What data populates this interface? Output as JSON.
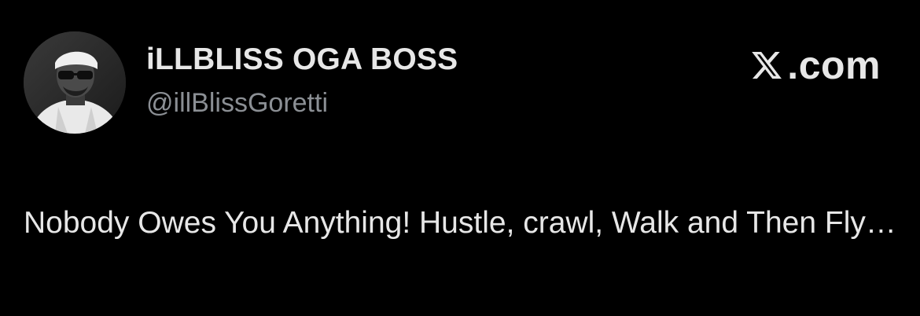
{
  "tweet": {
    "author": {
      "display_name": "iLLBLISS OGA BOSS",
      "handle": "@illBlissGoretti",
      "avatar_icon": "profile-photo"
    },
    "brand": {
      "logo_icon": "x-logo-icon",
      "text": ".com"
    },
    "text": "Nobody Owes You Anything! Hustle, crawl, Walk and Then Fly…"
  },
  "colors": {
    "background": "#000000",
    "primary_text": "#e7e7e7",
    "secondary_text": "#8b8f94"
  }
}
